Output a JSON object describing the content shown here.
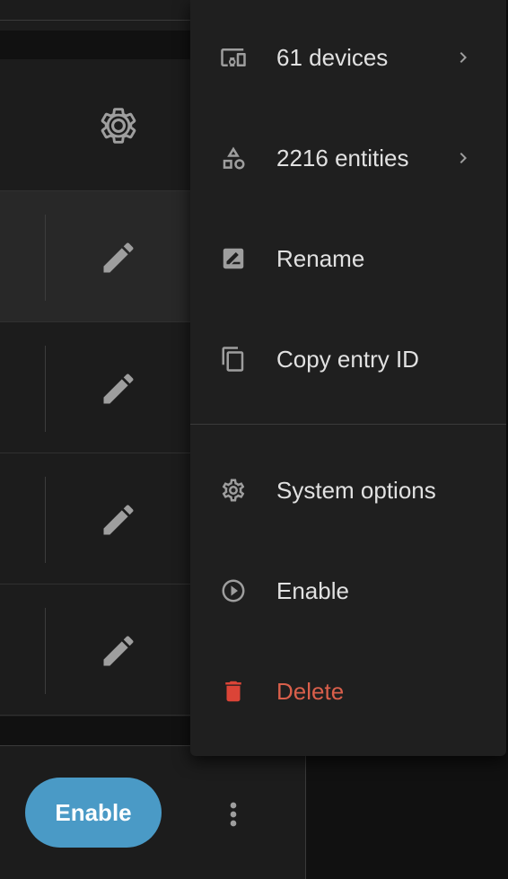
{
  "colors": {
    "background": "#111111",
    "card": "#1c1c1c",
    "menu": "#1f1f1f",
    "primary_button": "#4a9ac6",
    "delete": "#d95f4b",
    "icon": "#9e9e9e",
    "text": "#e1e1e1"
  },
  "card": {
    "header_icon": "gear-icon",
    "rows": [
      {
        "action_icon": "pencil-icon",
        "highlighted": true
      },
      {
        "action_icon": "pencil-icon",
        "highlighted": false
      },
      {
        "action_icon": "pencil-icon",
        "highlighted": false
      },
      {
        "action_icon": "pencil-icon",
        "highlighted": false
      }
    ],
    "footer": {
      "enable_label": "Enable",
      "more_icon": "dots-vertical-icon"
    }
  },
  "menu": {
    "items": [
      {
        "label": "61 devices",
        "icon": "devices-icon",
        "has_submenu": true
      },
      {
        "label": "2216 entities",
        "icon": "shapes-icon",
        "has_submenu": true
      },
      {
        "label": "Rename",
        "icon": "rename-box-icon",
        "has_submenu": false
      },
      {
        "label": "Copy entry ID",
        "icon": "content-copy-icon",
        "has_submenu": false
      },
      {
        "label": "System options",
        "icon": "gear-icon",
        "has_submenu": false
      },
      {
        "label": "Enable",
        "icon": "play-circle-icon",
        "has_submenu": false
      },
      {
        "label": "Delete",
        "icon": "delete-icon",
        "has_submenu": false
      }
    ]
  }
}
